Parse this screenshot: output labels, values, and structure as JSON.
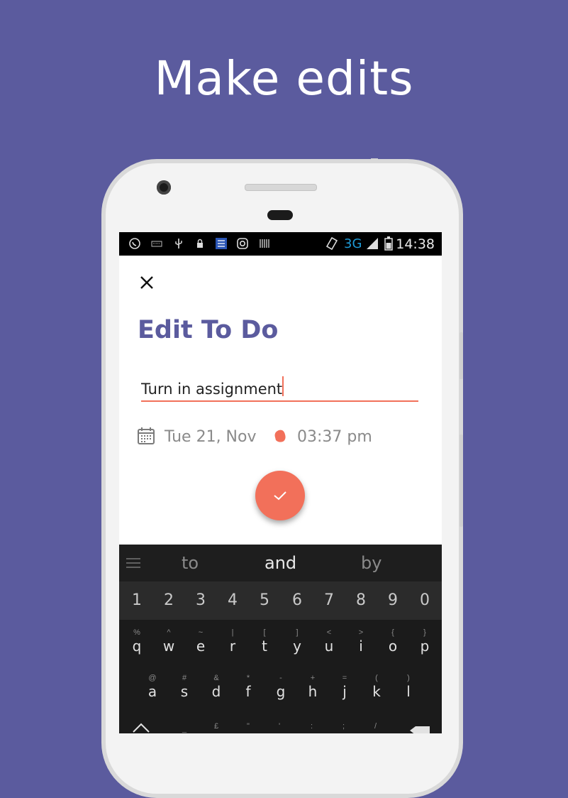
{
  "headline": "Make edits",
  "status_bar": {
    "network": "3G",
    "time": "14:38",
    "icons": [
      "whatsapp-icon",
      "keyboard-icon",
      "usb-icon",
      "lock-icon",
      "list-app-icon",
      "instagram-icon",
      "barcode-icon",
      "vibrate-icon",
      "signal-icon",
      "battery-icon"
    ]
  },
  "screen": {
    "title": "Edit To Do",
    "task_value": "Turn in assignment",
    "date": "Tue 21, Nov",
    "time": "03:37 pm"
  },
  "keyboard": {
    "suggestions": [
      "to",
      "and",
      "by"
    ],
    "numbers": [
      "1",
      "2",
      "3",
      "4",
      "5",
      "6",
      "7",
      "8",
      "9",
      "0"
    ],
    "row1": [
      {
        "main": "q",
        "sym": "%"
      },
      {
        "main": "w",
        "sym": "^"
      },
      {
        "main": "e",
        "sym": "~"
      },
      {
        "main": "r",
        "sym": "|"
      },
      {
        "main": "t",
        "sym": "["
      },
      {
        "main": "y",
        "sym": "]"
      },
      {
        "main": "u",
        "sym": "<"
      },
      {
        "main": "i",
        "sym": ">"
      },
      {
        "main": "o",
        "sym": "{"
      },
      {
        "main": "p",
        "sym": "}"
      }
    ],
    "row2": [
      {
        "main": "a",
        "sym": "@"
      },
      {
        "main": "s",
        "sym": "#"
      },
      {
        "main": "d",
        "sym": "&"
      },
      {
        "main": "f",
        "sym": "*"
      },
      {
        "main": "g",
        "sym": "-"
      },
      {
        "main": "h",
        "sym": "+"
      },
      {
        "main": "j",
        "sym": "="
      },
      {
        "main": "k",
        "sym": "("
      },
      {
        "main": "l",
        "sym": ")"
      }
    ],
    "row3_syms": [
      "_",
      "£",
      "\"",
      "'",
      ":",
      ";",
      "/"
    ]
  },
  "colors": {
    "background": "#5b5b9e",
    "accent": "#f2705a",
    "title": "#5b5b9e",
    "network": "#1e9ad6"
  }
}
